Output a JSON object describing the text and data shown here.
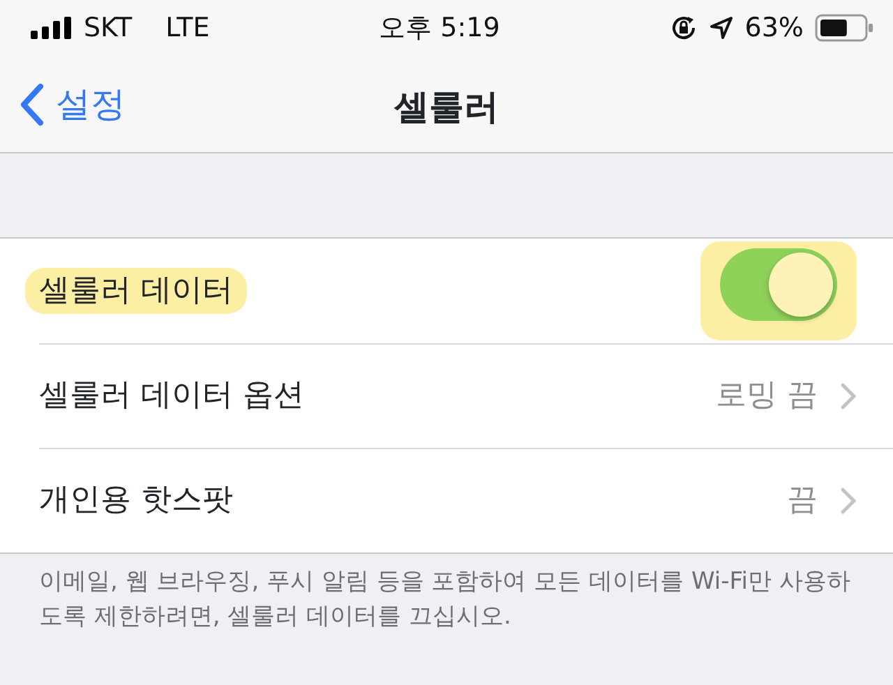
{
  "status_bar": {
    "carrier": "SKT",
    "network": "LTE",
    "time": "오후 5:19",
    "battery": "63%"
  },
  "nav": {
    "back": "설정",
    "title": "셀룰러"
  },
  "rows": [
    {
      "kind": "toggle",
      "label": "셀룰러 데이터",
      "on": true,
      "highlighted": true
    },
    {
      "kind": "link",
      "label": "셀룰러 데이터 옵션",
      "value": "로밍 끔",
      "highlighted": false
    },
    {
      "kind": "link",
      "label": "개인용 핫스팟",
      "value": "끔",
      "highlighted": false
    }
  ],
  "footer": "이메일, 웹 브라우징, 푸시 알림 등을 포함하여 모든 데이터를 Wi-Fi만 사용하도록 제한하려면, 셀룰러 데이터를 끄십시오."
}
